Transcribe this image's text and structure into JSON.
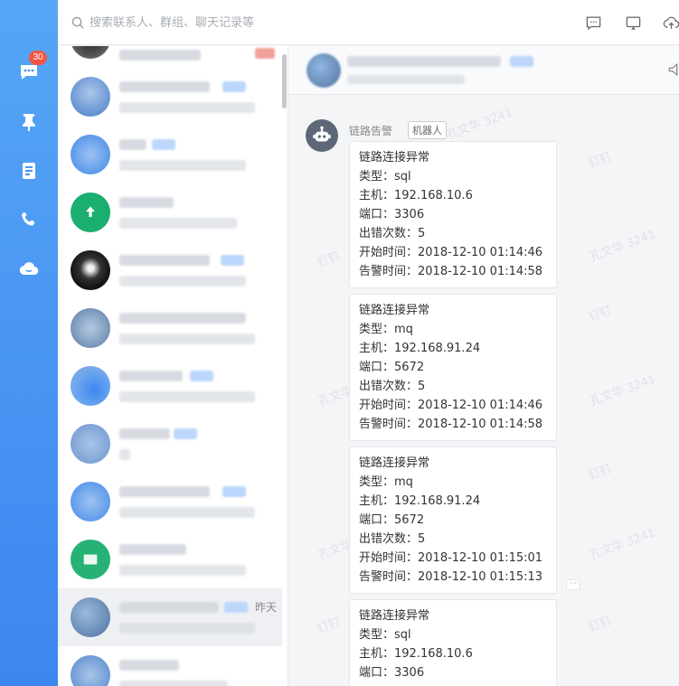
{
  "nav": {
    "unread_badge": "30",
    "items": [
      "chat-icon",
      "pin-icon",
      "contacts-icon",
      "phone-icon",
      "cloud-icon"
    ]
  },
  "search": {
    "placeholder": "搜索联系人、群组、聊天记录等"
  },
  "conversations": [
    {
      "time": ""
    },
    {
      "time": ""
    },
    {
      "time": ""
    },
    {
      "time": ""
    },
    {
      "time": ""
    },
    {
      "time": ""
    },
    {
      "time": ""
    },
    {
      "time": ""
    },
    {
      "time": ""
    },
    {
      "time": ""
    },
    {
      "time": "昨天"
    },
    {
      "time": ""
    }
  ],
  "chat": {
    "sender_name": "链路告警",
    "sender_tag": "机器人",
    "watermark_text": "孔文华 3241",
    "watermark_brand": "钉钉",
    "messages": [
      {
        "lines": [
          "链路连接异常",
          "类型：sql",
          "主机：192.168.10.6",
          "端口：3306",
          "出错次数：5",
          "开始时间：2018-12-10 01:14:46",
          "告警时间：2018-12-10 01:14:58"
        ]
      },
      {
        "lines": [
          "链路连接异常",
          "类型：mq",
          "主机：192.168.91.24",
          "端口：5672",
          "出错次数：5",
          "开始时间：2018-12-10 01:14:46",
          "告警时间：2018-12-10 01:14:58"
        ]
      },
      {
        "lines": [
          "链路连接异常",
          "类型：mq",
          "主机：192.168.91.24",
          "端口：5672",
          "出错次数：5",
          "开始时间：2018-12-10 01:15:01",
          "告警时间：2018-12-10 01:15:13"
        ]
      },
      {
        "lines": [
          "链路连接异常",
          "类型：sql",
          "主机：192.168.10.6",
          "端口：3306"
        ]
      }
    ],
    "more_label": "···"
  },
  "colors": {
    "rail": "#4a95f3",
    "accent": "#3296fa",
    "badge": "#f25643"
  }
}
